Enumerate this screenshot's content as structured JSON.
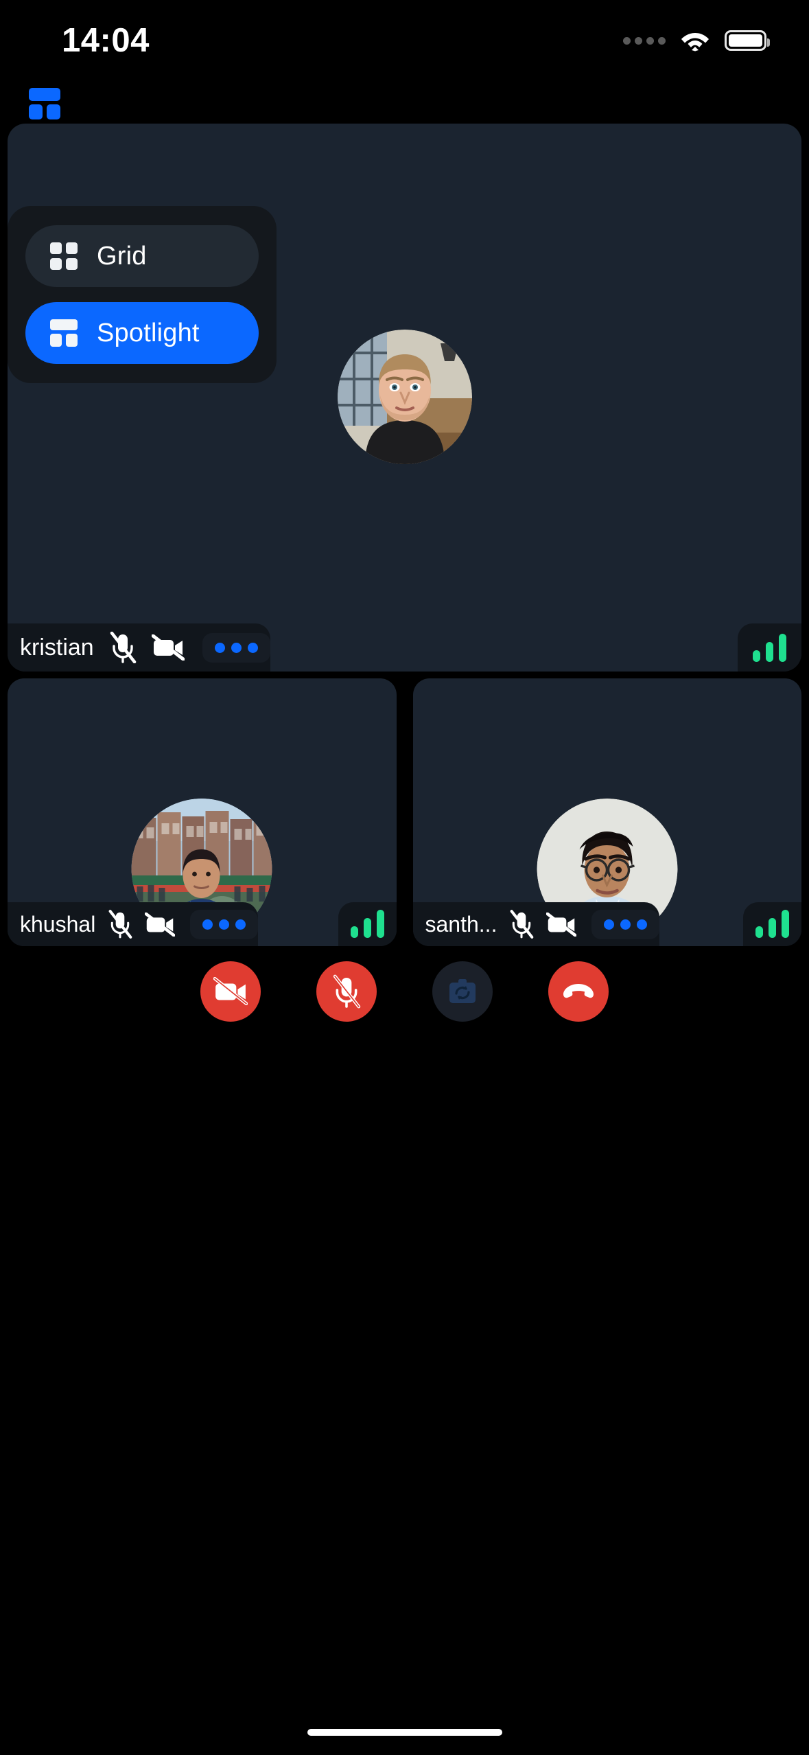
{
  "status_bar": {
    "time": "14:04",
    "cellular_icon": "cellular-dots-icon",
    "wifi_icon": "wifi-icon",
    "battery_icon": "battery-full-icon"
  },
  "layout_toggle": {
    "icon": "spotlight-layout-icon",
    "accent_color": "#0b68ff"
  },
  "layout_menu": {
    "visible": true,
    "items": [
      {
        "label": "Grid",
        "icon": "grid-layout-icon",
        "selected": false
      },
      {
        "label": "Spotlight",
        "icon": "spotlight-layout-icon",
        "selected": true
      }
    ],
    "selected_color": "#0b68ff",
    "unselected_color": "#222a33",
    "panel_color": "#14181d"
  },
  "call": {
    "spotlight_participant": {
      "name": "kristian",
      "mic_icon": "mic-off-icon",
      "camera_icon": "video-off-icon",
      "more_icon": "more-horizontal-icon",
      "signal_icon": "signal-bars-icon",
      "signal_strength": 3,
      "mic_muted": true,
      "camera_off": true,
      "avatar": "avatar-kristian"
    },
    "thumbnails": [
      {
        "name": "khushal",
        "mic_icon": "mic-off-icon",
        "camera_icon": "video-off-icon",
        "more_icon": "more-horizontal-icon",
        "signal_icon": "signal-bars-icon",
        "signal_strength": 3,
        "mic_muted": true,
        "camera_off": true,
        "avatar": "avatar-khushal"
      },
      {
        "name": "santh...",
        "mic_icon": "mic-off-icon",
        "camera_icon": "video-off-icon",
        "more_icon": "more-horizontal-icon",
        "signal_icon": "signal-bars-icon",
        "signal_strength": 3,
        "mic_muted": true,
        "camera_off": true,
        "avatar": "avatar-santhosh"
      }
    ]
  },
  "controls": [
    {
      "name": "toggle-camera-button",
      "icon": "video-off-icon",
      "style": "danger"
    },
    {
      "name": "toggle-mic-button",
      "icon": "mic-off-icon",
      "style": "danger"
    },
    {
      "name": "flip-camera-button",
      "icon": "camera-flip-icon",
      "style": "neutral"
    },
    {
      "name": "end-call-button",
      "icon": "phone-hangup-icon",
      "style": "danger"
    }
  ],
  "colors": {
    "accent_blue": "#0b68ff",
    "danger_red": "#e03c31",
    "signal_green": "#1fe08f",
    "tile_bg": "#1b2430",
    "namebar_bg": "#11161c",
    "page_bg": "#000000"
  },
  "home_indicator": "home-indicator"
}
